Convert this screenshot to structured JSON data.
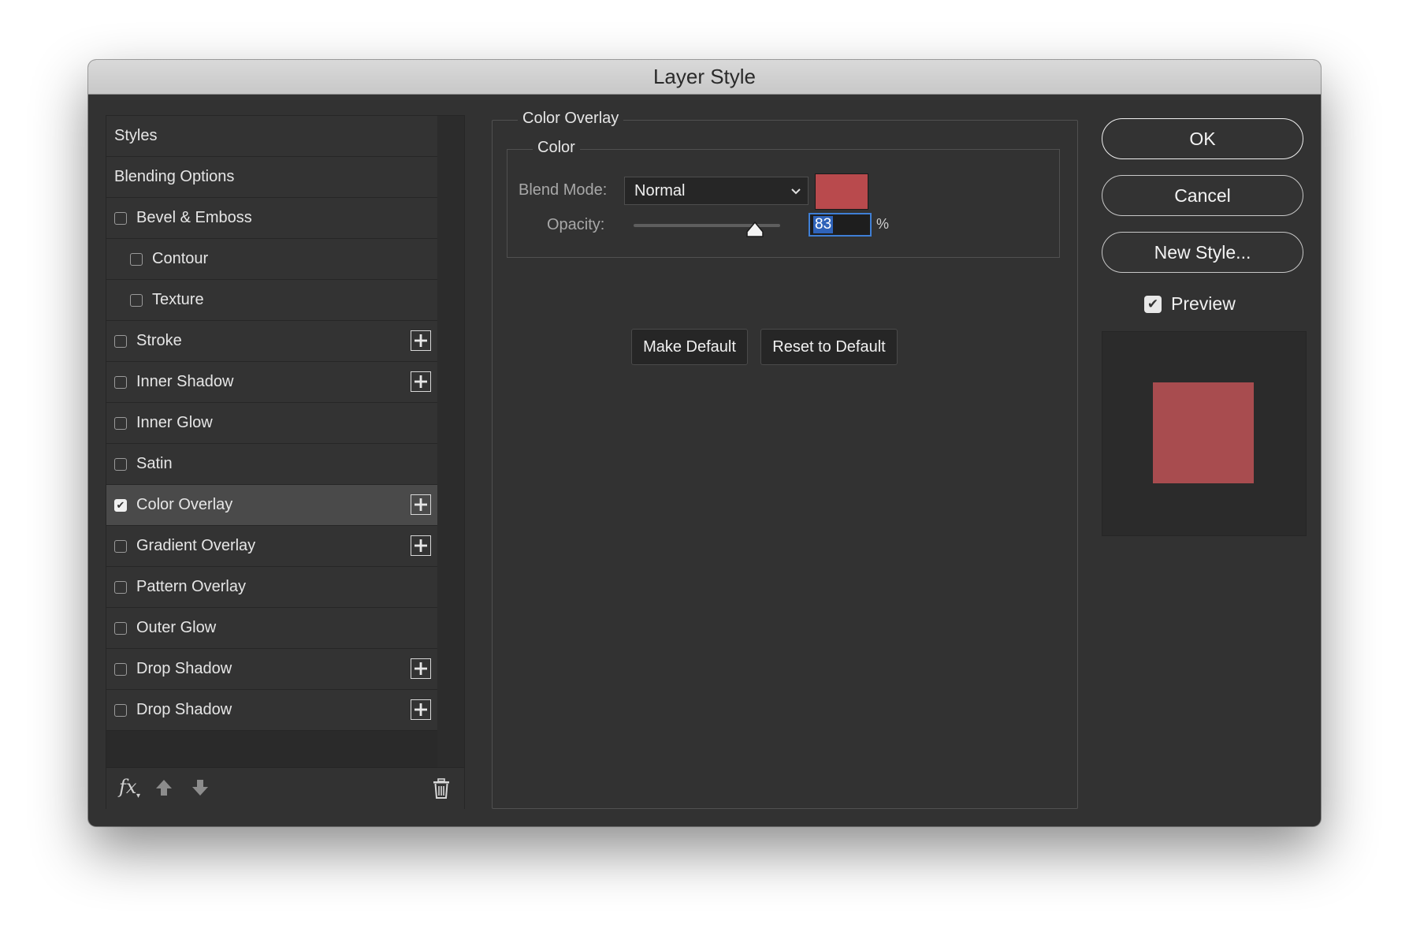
{
  "window": {
    "title": "Layer Style"
  },
  "styles_panel": {
    "items": [
      {
        "label": "Styles",
        "type": "header"
      },
      {
        "label": "Blending Options",
        "type": "header"
      },
      {
        "label": "Bevel & Emboss",
        "type": "check",
        "checked": false,
        "plus": false
      },
      {
        "label": "Contour",
        "type": "sub",
        "checked": false,
        "plus": false
      },
      {
        "label": "Texture",
        "type": "sub",
        "checked": false,
        "plus": false
      },
      {
        "label": "Stroke",
        "type": "check",
        "checked": false,
        "plus": true
      },
      {
        "label": "Inner Shadow",
        "type": "check",
        "checked": false,
        "plus": true
      },
      {
        "label": "Inner Glow",
        "type": "check",
        "checked": false,
        "plus": false
      },
      {
        "label": "Satin",
        "type": "check",
        "checked": false,
        "plus": false
      },
      {
        "label": "Color Overlay",
        "type": "check",
        "checked": true,
        "plus": true,
        "selected": true
      },
      {
        "label": "Gradient Overlay",
        "type": "check",
        "checked": false,
        "plus": true
      },
      {
        "label": "Pattern Overlay",
        "type": "check",
        "checked": false,
        "plus": false
      },
      {
        "label": "Outer Glow",
        "type": "check",
        "checked": false,
        "plus": false
      },
      {
        "label": "Drop Shadow",
        "type": "check",
        "checked": false,
        "plus": true
      },
      {
        "label": "Drop Shadow",
        "type": "check",
        "checked": false,
        "plus": true
      }
    ],
    "footer": {
      "fx_label": "fx"
    }
  },
  "color_overlay": {
    "section_title": "Color Overlay",
    "group_title": "Color",
    "blend_mode_label": "Blend Mode:",
    "blend_mode_value": "Normal",
    "overlay_color": "#b94a4d",
    "opacity_label": "Opacity:",
    "opacity_value": "83",
    "opacity_unit": "%",
    "make_default_label": "Make Default",
    "reset_default_label": "Reset to Default"
  },
  "actions": {
    "ok_label": "OK",
    "cancel_label": "Cancel",
    "new_style_label": "New Style...",
    "preview_label": "Preview",
    "preview_checked": true
  },
  "preview": {
    "swatch_color": "#a84c4f"
  }
}
